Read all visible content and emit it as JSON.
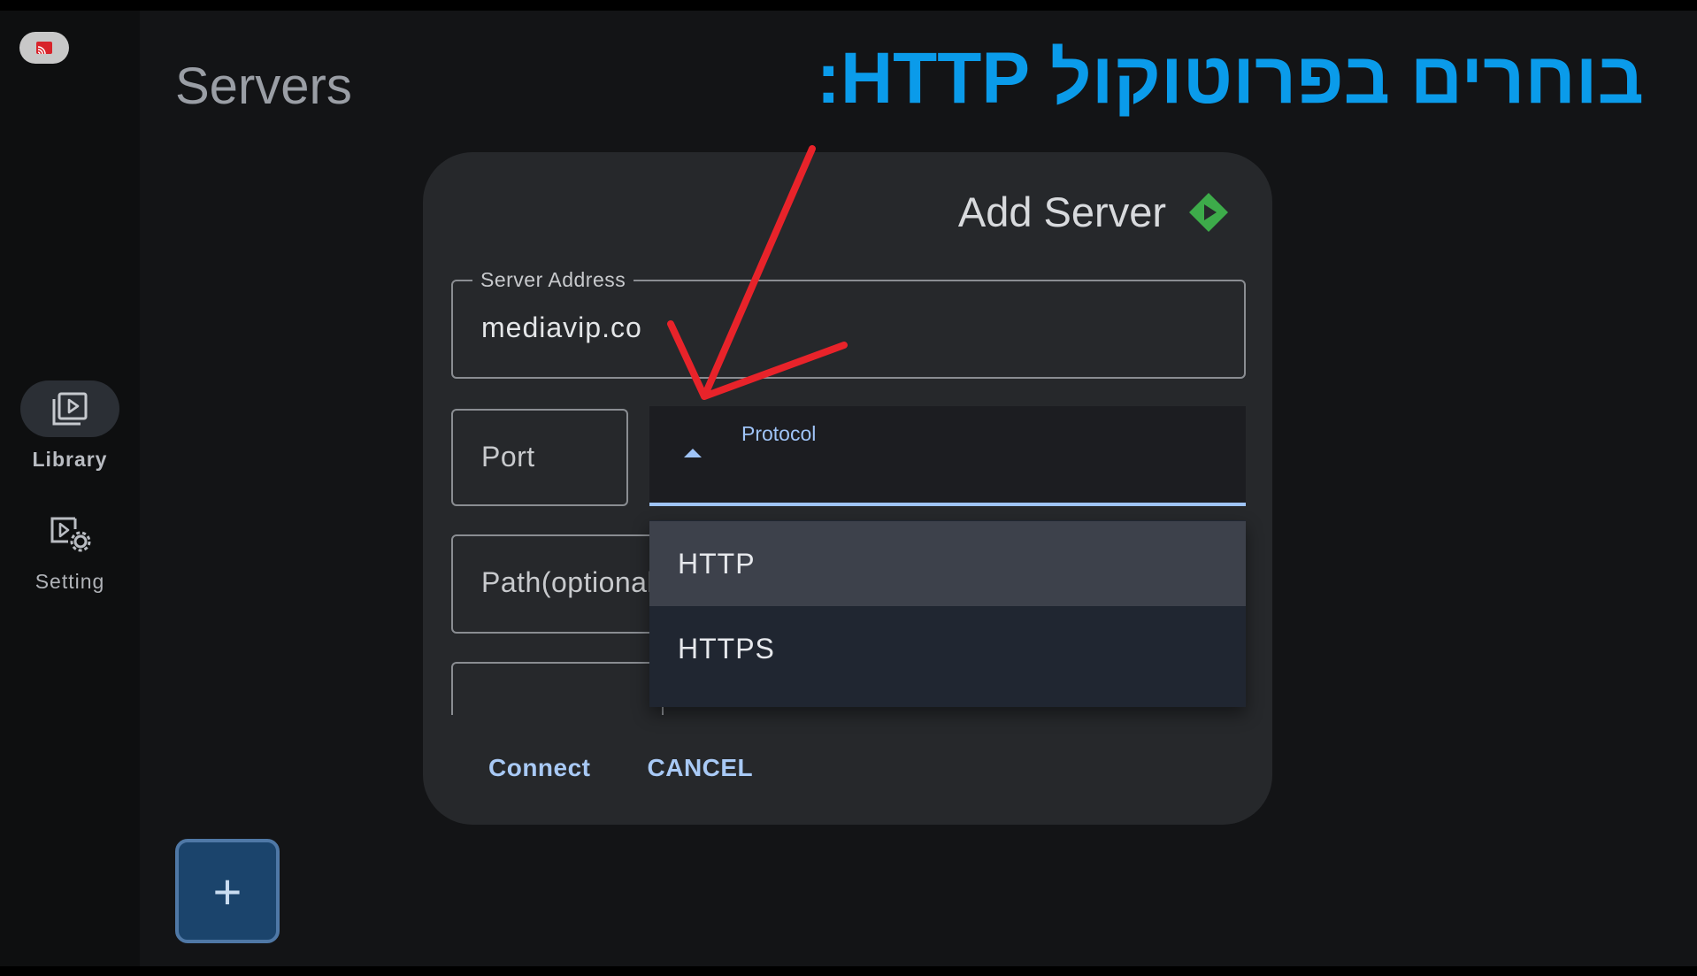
{
  "page": {
    "title": "Servers"
  },
  "annotation": {
    "text": "בוחרים בפרוטוקול HTTP:"
  },
  "sidebar": {
    "items": [
      {
        "label": "Library",
        "icon": "library-play-icon",
        "active": true
      },
      {
        "label": "Setting",
        "icon": "video-settings-icon",
        "active": false
      }
    ]
  },
  "dialog": {
    "title": "Add Server",
    "logo_icon": "green-diamond-play-icon",
    "server_address": {
      "label": "Server Address",
      "value": "mediavip.co"
    },
    "port": {
      "placeholder": "Port"
    },
    "path": {
      "placeholder": "Path(optional)"
    },
    "protocol": {
      "label": "Protocol",
      "expanded": true,
      "options": [
        "HTTP",
        "HTTPS"
      ],
      "highlighted": "HTTP"
    },
    "buttons": {
      "connect": "Connect",
      "cancel": "CANCEL"
    }
  },
  "fab": {
    "label": "+"
  },
  "colors": {
    "accent": "#9fc4f8",
    "annotation": "#0a9bea",
    "arrow": "#e8232a",
    "logo": "#3dab4a",
    "fab": "#1b446c"
  }
}
